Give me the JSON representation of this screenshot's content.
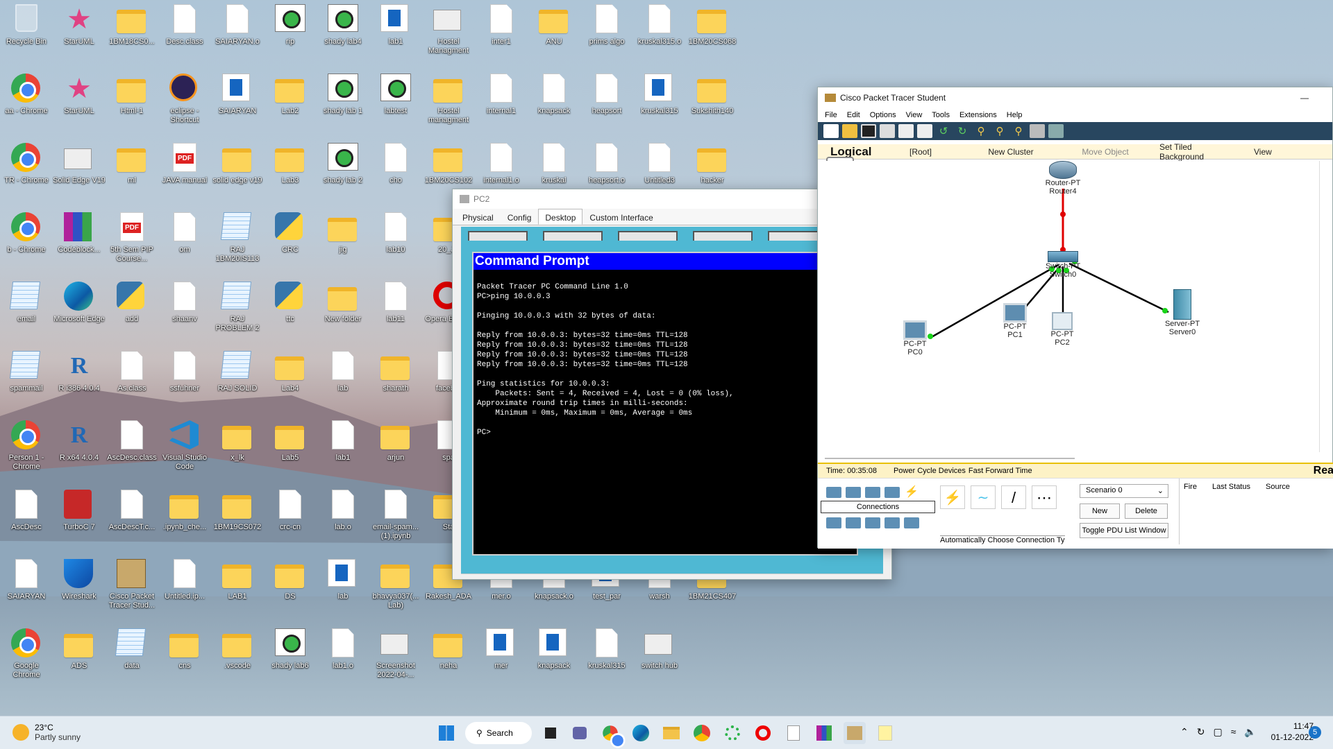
{
  "desktop": {
    "icons": [
      {
        "label": "Recycle Bin",
        "icon": "bin"
      },
      {
        "label": "StarUML",
        "icon": "star"
      },
      {
        "label": "1BM18CS0...",
        "icon": "folder"
      },
      {
        "label": "Desc.class",
        "icon": "file"
      },
      {
        "label": "SAIARYAN.o",
        "icon": "file"
      },
      {
        "label": "rip",
        "icon": "shady"
      },
      {
        "label": "shady lab4",
        "icon": "shady"
      },
      {
        "label": "lab1",
        "icon": "blue"
      },
      {
        "label": "Hostel Managment",
        "icon": "html"
      },
      {
        "label": "inter1",
        "icon": "file"
      },
      {
        "label": "ANU",
        "icon": "folder"
      },
      {
        "label": "prims algo",
        "icon": "file"
      },
      {
        "label": "kruskal315.o",
        "icon": "file"
      },
      {
        "label": "1BM20CS068",
        "icon": "folder"
      },
      {
        "label": "aa - Chrome",
        "icon": "chrome"
      },
      {
        "label": "StarUML",
        "icon": "star"
      },
      {
        "label": "Html-1",
        "icon": "folder"
      },
      {
        "label": "eclipse - Shortcut",
        "icon": "eclipse"
      },
      {
        "label": "SAIARYAN",
        "icon": "blue"
      },
      {
        "label": "Lab2",
        "icon": "folder"
      },
      {
        "label": "shady lab 1",
        "icon": "shady"
      },
      {
        "label": "labtest",
        "icon": "shady"
      },
      {
        "label": "Hostel managment",
        "icon": "folder"
      },
      {
        "label": "internal1",
        "icon": "file"
      },
      {
        "label": "knapsack",
        "icon": "file"
      },
      {
        "label": "heapsort",
        "icon": "file"
      },
      {
        "label": "kruskal315",
        "icon": "blue"
      },
      {
        "label": "Sukshith140",
        "icon": "folder"
      },
      {
        "label": "TR - Chrome",
        "icon": "chrome"
      },
      {
        "label": "Solid Edge V19",
        "icon": "html"
      },
      {
        "label": "ml",
        "icon": "folder"
      },
      {
        "label": "JAVA manual",
        "icon": "pdf"
      },
      {
        "label": "solid edge v19",
        "icon": "folder"
      },
      {
        "label": "Lab3",
        "icon": "folder"
      },
      {
        "label": "shady lab 2",
        "icon": "shady"
      },
      {
        "label": "cho",
        "icon": "file"
      },
      {
        "label": "1BM20CS102",
        "icon": "folder"
      },
      {
        "label": "internal1.o",
        "icon": "file"
      },
      {
        "label": "kruskal",
        "icon": "file"
      },
      {
        "label": "heapsort.o",
        "icon": "file"
      },
      {
        "label": "Untitled3",
        "icon": "file"
      },
      {
        "label": "hacker",
        "icon": "folder"
      },
      {
        "label": "b - Chrome",
        "icon": "chrome"
      },
      {
        "label": "Codeblock...",
        "icon": "rar"
      },
      {
        "label": "5th Sem PIP Course...",
        "icon": "pdf"
      },
      {
        "label": "om",
        "icon": "file"
      },
      {
        "label": "RAJ 1BM20IS113",
        "icon": "notepad"
      },
      {
        "label": "CRC",
        "icon": "py"
      },
      {
        "label": "jig",
        "icon": "folder"
      },
      {
        "label": "lab10",
        "icon": "file"
      },
      {
        "label": "20_Ja",
        "icon": "folder"
      },
      {
        "label": "email",
        "icon": "notepad"
      },
      {
        "label": "Microsoft Edge",
        "icon": "edge"
      },
      {
        "label": "add",
        "icon": "py"
      },
      {
        "label": "shaanv",
        "icon": "file"
      },
      {
        "label": "RAJ PROBLEM 2",
        "icon": "notepad"
      },
      {
        "label": "ttc",
        "icon": "py"
      },
      {
        "label": "New folder",
        "icon": "folder"
      },
      {
        "label": "lab11",
        "icon": "file"
      },
      {
        "label": "Opera Brow...",
        "icon": "opera"
      },
      {
        "label": "spammail",
        "icon": "notepad"
      },
      {
        "label": "R i386 4.0.4",
        "icon": "r"
      },
      {
        "label": "As.class",
        "icon": "file"
      },
      {
        "label": "ssfuhner",
        "icon": "file"
      },
      {
        "label": "RAJ SOLID",
        "icon": "notepad"
      },
      {
        "label": "Lab4",
        "icon": "folder"
      },
      {
        "label": "lab",
        "icon": "file"
      },
      {
        "label": "sharath",
        "icon": "folder"
      },
      {
        "label": "faceb...",
        "icon": "file"
      },
      {
        "label": "Person 1 - Chrome",
        "icon": "chrome"
      },
      {
        "label": "R x64 4.0.4",
        "icon": "r"
      },
      {
        "label": "AscDesc.class",
        "icon": "file"
      },
      {
        "label": "Visual Studio Code",
        "icon": "vs"
      },
      {
        "label": "x_lk",
        "icon": "folder"
      },
      {
        "label": "Lab5",
        "icon": "folder"
      },
      {
        "label": "lab1",
        "icon": "file"
      },
      {
        "label": "arjun",
        "icon": "folder"
      },
      {
        "label": "spa",
        "icon": "file"
      },
      {
        "label": "AscDesc",
        "icon": "file"
      },
      {
        "label": "TurboC 7",
        "icon": "turbo"
      },
      {
        "label": "AscDescT.c...",
        "icon": "file"
      },
      {
        "label": ".ipynb_che...",
        "icon": "folder"
      },
      {
        "label": "1BM19CS072",
        "icon": "folder"
      },
      {
        "label": "crc-cn",
        "icon": "file"
      },
      {
        "label": "lab.o",
        "icon": "file"
      },
      {
        "label": "email-spam...(1).ipynb",
        "icon": "file"
      },
      {
        "label": "Sta",
        "icon": "folder"
      },
      {
        "label": "SAIARYAN",
        "icon": "file"
      },
      {
        "label": "Wireshark",
        "icon": "ws"
      },
      {
        "label": "Cisco Packet Tracer Stud...",
        "icon": "pkt"
      },
      {
        "label": "Untitled.ip...",
        "icon": "file"
      },
      {
        "label": "LAB1",
        "icon": "folder"
      },
      {
        "label": "DS",
        "icon": "folder"
      },
      {
        "label": "lab",
        "icon": "blue"
      },
      {
        "label": "bhavya037(... Lab)",
        "icon": "folder"
      },
      {
        "label": "Rakesh_ADA",
        "icon": "folder"
      },
      {
        "label": "mer.o",
        "icon": "file"
      },
      {
        "label": "knapsack.o",
        "icon": "file"
      },
      {
        "label": "test_par",
        "icon": "blue"
      },
      {
        "label": "warsh",
        "icon": "file"
      },
      {
        "label": "1BM21CS407",
        "icon": "folder"
      },
      {
        "label": "Google Chrome",
        "icon": "chrome"
      },
      {
        "label": "ADS",
        "icon": "folder"
      },
      {
        "label": "data",
        "icon": "notepad"
      },
      {
        "label": "cns",
        "icon": "folder"
      },
      {
        "label": ".vscode",
        "icon": "folder"
      },
      {
        "label": "shady lab6",
        "icon": "shady"
      },
      {
        "label": "lab1.o",
        "icon": "file"
      },
      {
        "label": "Screenshot 2022-04-...",
        "icon": "html"
      },
      {
        "label": "neha",
        "icon": "folder"
      },
      {
        "label": "mer",
        "icon": "blue"
      },
      {
        "label": "knapsack",
        "icon": "blue"
      },
      {
        "label": "kruskal315",
        "icon": "file"
      },
      {
        "label": "switch hub",
        "icon": "html"
      }
    ]
  },
  "pc2": {
    "title": "PC2",
    "tabs": [
      "Physical",
      "Config",
      "Desktop",
      "Custom Interface"
    ],
    "cmd_title": "Command Prompt",
    "cmd_text": "Packet Tracer PC Command Line 1.0\nPC>ping 10.0.0.3\n\nPinging 10.0.0.3 with 32 bytes of data:\n\nReply from 10.0.0.3: bytes=32 time=0ms TTL=128\nReply from 10.0.0.3: bytes=32 time=0ms TTL=128\nReply from 10.0.0.3: bytes=32 time=0ms TTL=128\nReply from 10.0.0.3: bytes=32 time=0ms TTL=128\n\nPing statistics for 10.0.0.3:\n    Packets: Sent = 4, Received = 4, Lost = 0 (0% loss),\nApproximate round trip times in milli-seconds:\n    Minimum = 0ms, Maximum = 0ms, Average = 0ms\n\nPC>"
  },
  "pt": {
    "title": "Cisco Packet Tracer Student",
    "menu": [
      "File",
      "Edit",
      "Options",
      "View",
      "Tools",
      "Extensions",
      "Help"
    ],
    "logical": "Logical",
    "root": "[Root]",
    "new_cluster": "New Cluster",
    "move_object": "Move Object",
    "set_tiled": "Set Tiled Background",
    "view": "View",
    "nodes": {
      "router": [
        "Router-PT",
        "Router4"
      ],
      "switch": [
        "Switch-PT",
        "Switch0"
      ],
      "pc0": [
        "PC-PT",
        "PC0"
      ],
      "pc1": [
        "PC-PT",
        "PC1"
      ],
      "pc2": [
        "PC-PT",
        "PC2"
      ],
      "server": [
        "Server-PT",
        "Server0"
      ]
    },
    "time": "Time: 00:35:08",
    "power_cycle": "Power Cycle Devices",
    "fast_forward": "Fast Forward Time",
    "realtime": "Rea",
    "connections": "Connections",
    "auto_conn": "Automatically Choose Connection Type",
    "scenario": "Scenario 0",
    "new_btn": "New",
    "delete_btn": "Delete",
    "toggle_pdu": "Toggle PDU List Window",
    "cols": [
      "Fire",
      "Last Status",
      "Source"
    ]
  },
  "taskbar": {
    "temp": "23°C",
    "weather": "Partly sunny",
    "search": "Search",
    "time": "11:47",
    "date": "01-12-2022",
    "badge": "5"
  },
  "colors": {
    "folder": "#fcd45a",
    "cmd_bg": "#000000",
    "cmd_title": "#0000ff",
    "link_red": "#e00000",
    "status_bar": "#fdf2c6"
  }
}
